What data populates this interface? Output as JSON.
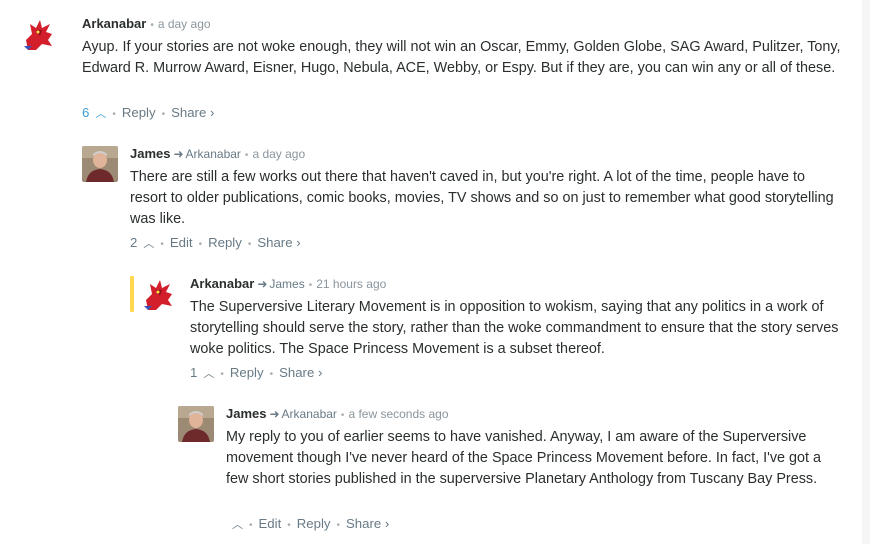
{
  "comments": [
    {
      "author": "Arkanabar",
      "reply_to": "",
      "time": "a day ago",
      "text": "Ayup. If your stories are not woke enough, they will not win an Oscar, Emmy, Golden Globe, SAG Award, Pulitzer, Tony, Edward R. Murrow Award, Eisner, Hugo, Nebula, ACE, Webby, or Espy. But if they are, you can win any or all of these.",
      "votes": "6",
      "reply": "Reply",
      "share": "Share ›",
      "avatar": "red-dragon-avatar"
    },
    {
      "author": "James",
      "reply_to": "Arkanabar",
      "time": "a day ago",
      "text": "There are still a few works out there that haven't caved in, but you're right. A lot of the time, people have to resort to older publications, comic books, movies, TV shows and so on just to remember what good storytelling was like.",
      "votes": "2",
      "edit": "Edit",
      "reply": "Reply",
      "share": "Share ›",
      "avatar": "man-photo-avatar"
    },
    {
      "author": "Arkanabar",
      "reply_to": "James",
      "time": "21 hours ago",
      "text": "The Superversive Literary Movement is in opposition to wokism, saying that any politics in a work of storytelling should serve the story, rather than the woke commandment to ensure that the story serves woke politics. The Space Princess Movement is a subset thereof.",
      "votes": "1",
      "reply": "Reply",
      "share": "Share ›",
      "avatar": "red-dragon-avatar"
    },
    {
      "author": "James",
      "reply_to": "Arkanabar",
      "time": "a few seconds ago",
      "text": "My reply to you of earlier seems to have vanished. Anyway, I am aware of the Superversive movement though I've never heard of the Space Princess Movement before. In fact, I've got a few short stories published in the superversive Planetary Anthology from Tuscany Bay Press.",
      "votes": "",
      "edit": "Edit",
      "reply": "Reply",
      "share": "Share ›",
      "avatar": "man-photo-avatar"
    }
  ],
  "colors": {
    "highlight_bar": "#ffd84d",
    "upvote_active": "#3b9fd6",
    "meta": "#687a86"
  }
}
